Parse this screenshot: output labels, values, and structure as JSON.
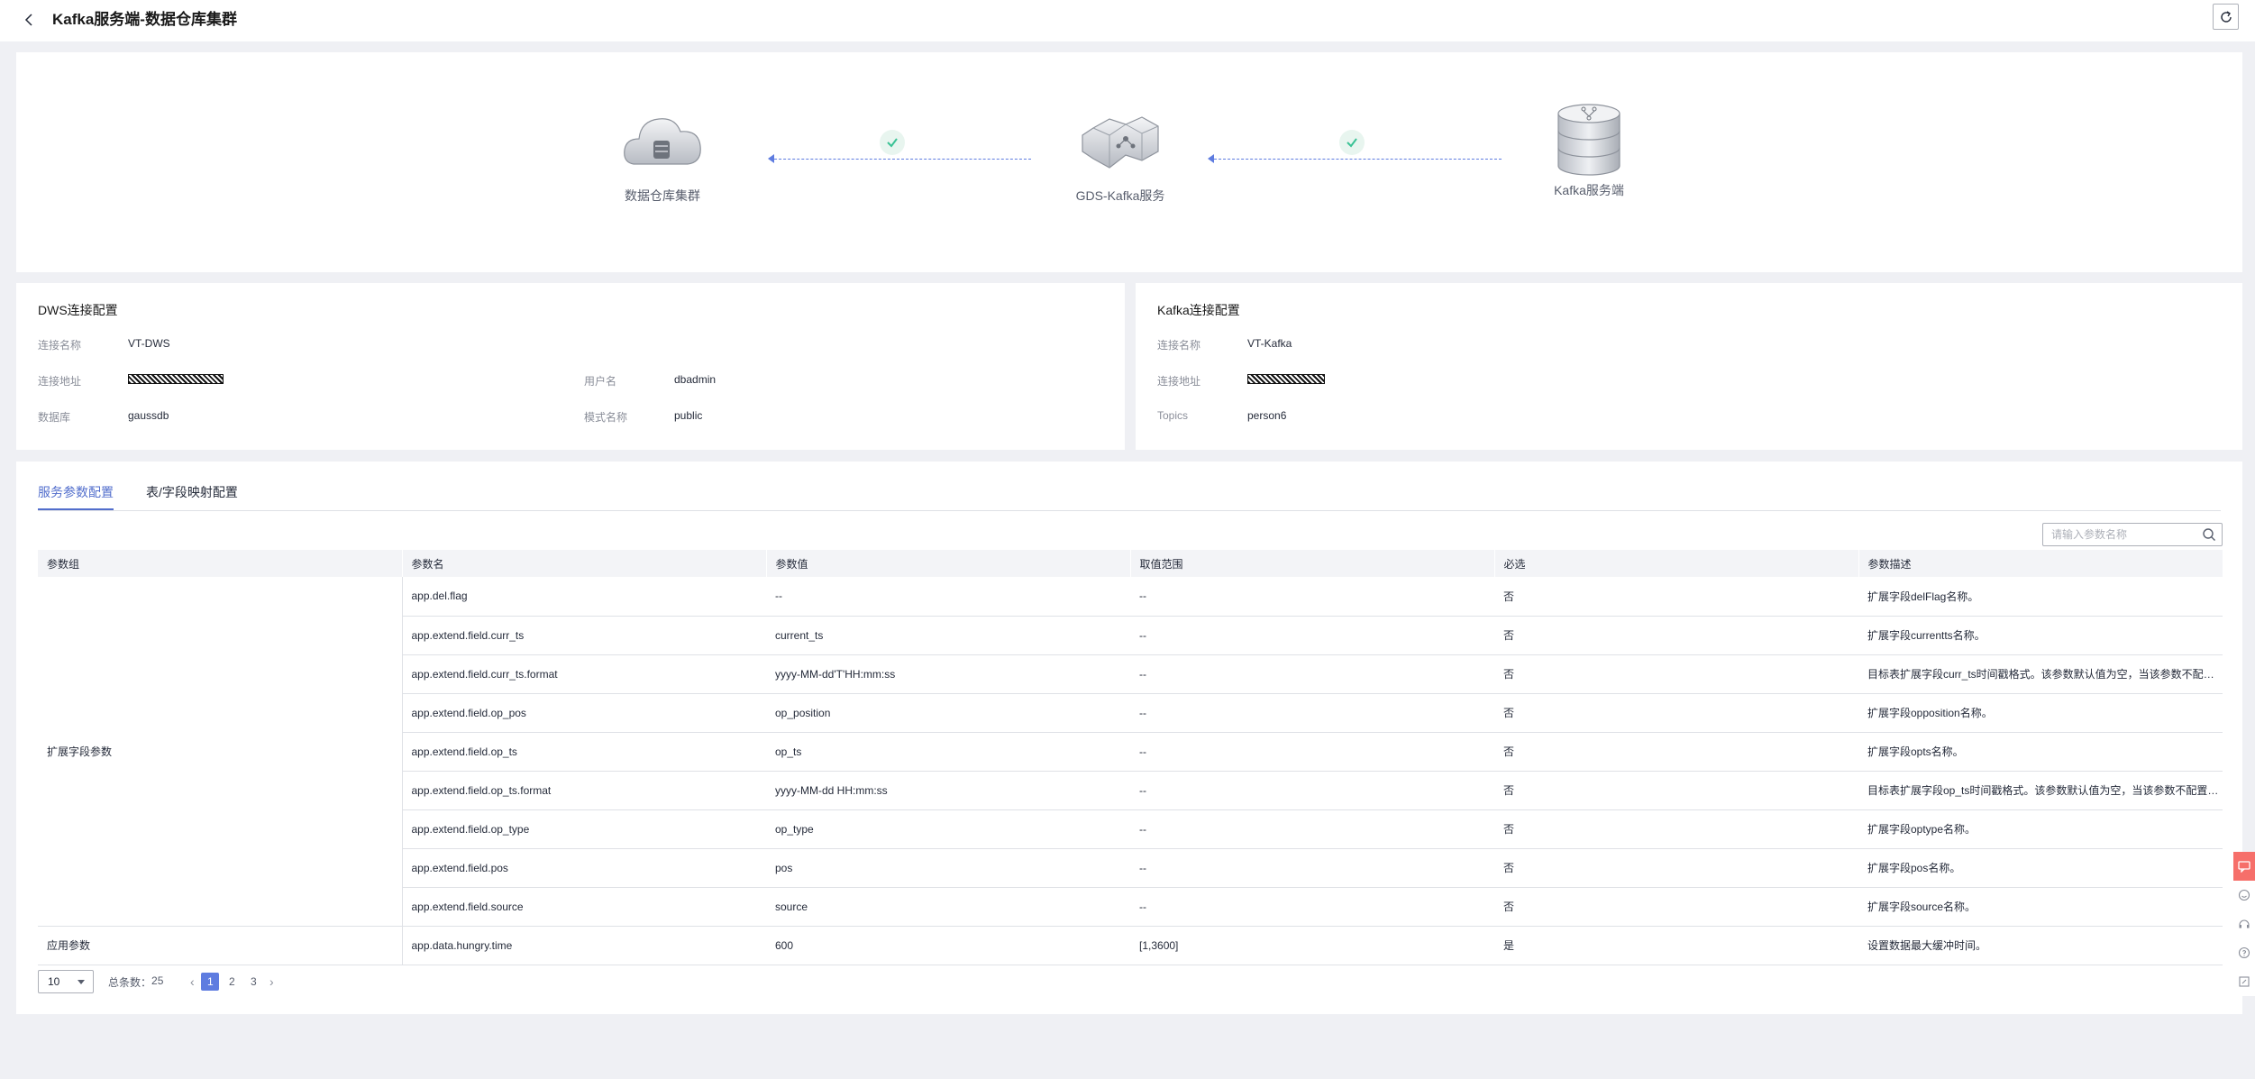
{
  "header": {
    "title": "Kafka服务端-数据仓库集群"
  },
  "flow": {
    "nodes": [
      {
        "label": "数据仓库集群"
      },
      {
        "label": "GDS-Kafka服务"
      },
      {
        "label": "Kafka服务端"
      }
    ]
  },
  "dws": {
    "title": "DWS连接配置",
    "name_label": "连接名称",
    "name": "VT-DWS",
    "addr_label": "连接地址",
    "user_label": "用户名",
    "user": "dbadmin",
    "db_label": "数据库",
    "db": "gaussdb",
    "schema_label": "模式名称",
    "schema": "public"
  },
  "kafka": {
    "title": "Kafka连接配置",
    "name_label": "连接名称",
    "name": "VT-Kafka",
    "addr_label": "连接地址",
    "topics_label": "Topics",
    "topics": "person6"
  },
  "tabs": [
    {
      "label": "服务参数配置",
      "active": true
    },
    {
      "label": "表/字段映射配置",
      "active": false
    }
  ],
  "search": {
    "placeholder": "请输入参数名称"
  },
  "table": {
    "headers": [
      "参数组",
      "参数名",
      "参数值",
      "取值范围",
      "必选",
      "参数描述"
    ],
    "groups": [
      {
        "name": "扩展字段参数",
        "row_count": 9
      },
      {
        "name": "应用参数",
        "row_count": 1
      }
    ],
    "rows": [
      {
        "name": "app.del.flag",
        "value": "--",
        "range": "--",
        "required": "否",
        "desc": "扩展字段delFlag名称。"
      },
      {
        "name": "app.extend.field.curr_ts",
        "value": "current_ts",
        "range": "--",
        "required": "否",
        "desc": "扩展字段currentts名称。"
      },
      {
        "name": "app.extend.field.curr_ts.format",
        "value": "yyyy-MM-dd'T'HH:mm:ss",
        "range": "--",
        "required": "否",
        "desc": "目标表扩展字段curr_ts时间戳格式。该参数默认值为空，当该参数不配置时..."
      },
      {
        "name": "app.extend.field.op_pos",
        "value": "op_position",
        "range": "--",
        "required": "否",
        "desc": "扩展字段opposition名称。"
      },
      {
        "name": "app.extend.field.op_ts",
        "value": "op_ts",
        "range": "--",
        "required": "否",
        "desc": "扩展字段opts名称。"
      },
      {
        "name": "app.extend.field.op_ts.format",
        "value": "yyyy-MM-dd HH:mm:ss",
        "range": "--",
        "required": "否",
        "desc": "目标表扩展字段op_ts时间戳格式。该参数默认值为空，当该参数不配置时..."
      },
      {
        "name": "app.extend.field.op_type",
        "value": "op_type",
        "range": "--",
        "required": "否",
        "desc": "扩展字段optype名称。"
      },
      {
        "name": "app.extend.field.pos",
        "value": "pos",
        "range": "--",
        "required": "否",
        "desc": "扩展字段pos名称。"
      },
      {
        "name": "app.extend.field.source",
        "value": "source",
        "range": "--",
        "required": "否",
        "desc": "扩展字段source名称。"
      },
      {
        "name": "app.data.hungry.time",
        "value": "600",
        "range": "[1,3600]",
        "required": "是",
        "desc": "设置数据最大缓冲时间。"
      }
    ]
  },
  "pager": {
    "page_size": "10",
    "total_label": "总条数：",
    "total": "25",
    "pages": [
      "1",
      "2",
      "3"
    ],
    "current": "1"
  },
  "colors": {
    "primary": "#5e7ce0",
    "success": "#3ac295",
    "feedback": "#f66f6a"
  }
}
